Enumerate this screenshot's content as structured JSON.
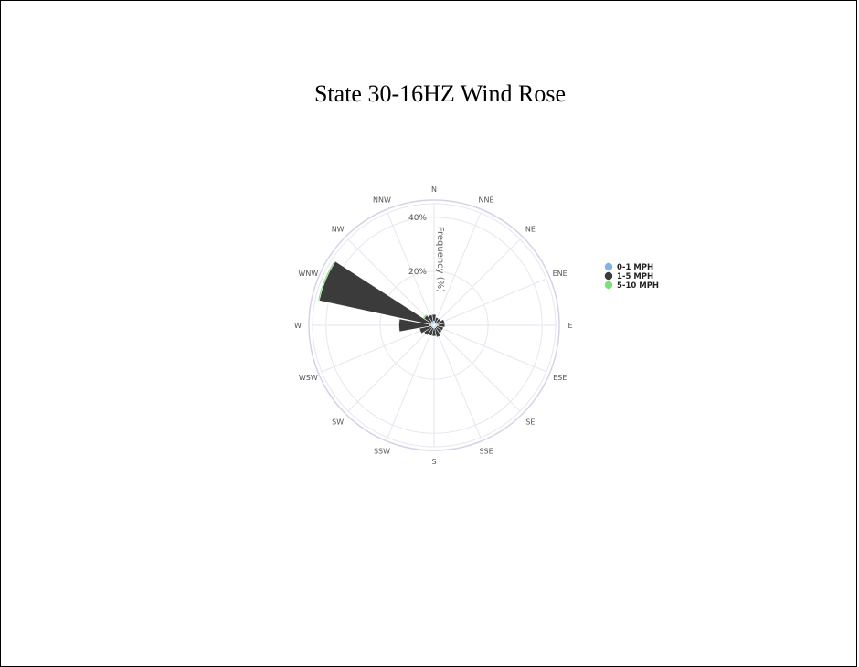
{
  "title": "State 30-16HZ Wind Rose",
  "chart_data": {
    "type": "windrose",
    "title": "State 30-16HZ Wind Rose",
    "radial_axis_label": "Frequency (%)",
    "radial_ticks": [
      "20%",
      "40%"
    ],
    "radial_tick_values": [
      20,
      40
    ],
    "rmax": 45,
    "directions": [
      "N",
      "NNE",
      "NE",
      "ENE",
      "E",
      "ESE",
      "SE",
      "SSE",
      "S",
      "SSW",
      "SW",
      "WSW",
      "W",
      "WNW",
      "NW",
      "NNW"
    ],
    "legend_placement": "right",
    "series": [
      {
        "name": "0-1 MPH",
        "color": "#7fb3e6",
        "values": [
          1.5,
          1.0,
          1.0,
          1.5,
          1.5,
          1.0,
          1.0,
          1.0,
          1.0,
          1.0,
          1.0,
          1.0,
          1.5,
          2.0,
          1.5,
          1.5
        ]
      },
      {
        "name": "1-5 MPH",
        "color": "#3b3b3b",
        "values": [
          2.5,
          2.0,
          2.0,
          2.5,
          2.5,
          2.5,
          2.5,
          3.5,
          3.0,
          3.0,
          3.5,
          4.5,
          11.5,
          41.5,
          3.0,
          2.5
        ]
      },
      {
        "name": "5-10 MPH",
        "color": "#7be07b",
        "values": [
          0.0,
          0.0,
          0.0,
          0.0,
          0.0,
          0.0,
          0.0,
          0.0,
          0.0,
          0.0,
          0.0,
          0.0,
          0.0,
          0.5,
          0.5,
          0.0
        ]
      }
    ]
  }
}
